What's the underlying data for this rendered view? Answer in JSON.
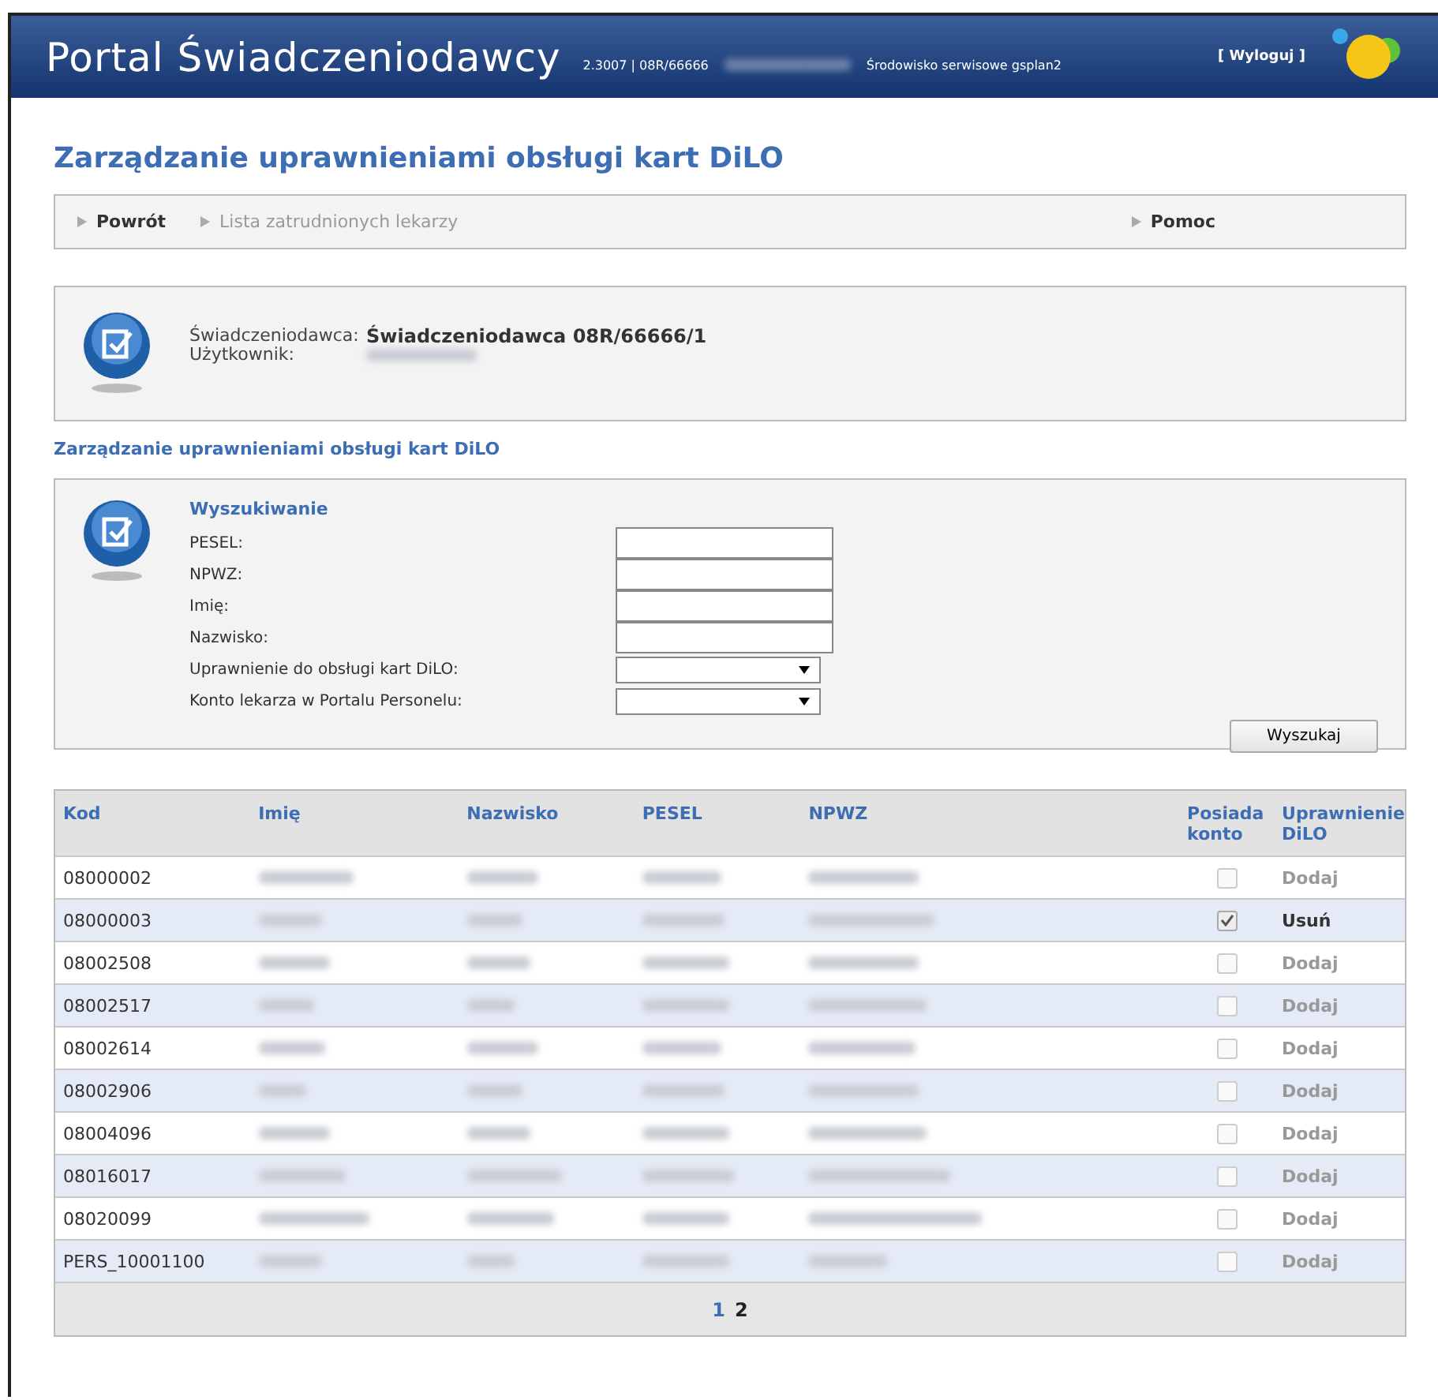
{
  "header": {
    "title": "Portal Świadczeniodawcy",
    "info": "2.3007 | 08R/66666",
    "environment": "Środowisko serwisowe gsplan2",
    "logout": "[ Wyloguj ]"
  },
  "page_title": "Zarządzanie uprawnieniami obsługi kart DiLO",
  "nav": [
    {
      "label": "Powrót",
      "disabled": false
    },
    {
      "label": "Lista zatrudnionych lekarzy",
      "disabled": true
    },
    {
      "label": "Pomoc",
      "disabled": false
    }
  ],
  "provider": {
    "provider_label": "Świadczeniodawca:",
    "provider_value": "Świadczeniodawca 08R/66666/1",
    "user_label": "Użytkownik:"
  },
  "section_title": "Zarządzanie uprawnieniami obsługi kart DiLO",
  "search": {
    "title": "Wyszukiwanie",
    "fields": [
      {
        "label": "PESEL:",
        "kind": "text"
      },
      {
        "label": "NPWZ:",
        "kind": "text"
      },
      {
        "label": "Imię:",
        "kind": "text"
      },
      {
        "label": "Nazwisko:",
        "kind": "text"
      },
      {
        "label": "Uprawnienie do obsługi kart DiLO:",
        "kind": "select"
      },
      {
        "label": "Konto lekarza w Portalu Personelu:",
        "kind": "select"
      }
    ],
    "button": "Wyszukaj"
  },
  "table": {
    "columns": [
      "Kod",
      "Imię",
      "Nazwisko",
      "PESEL",
      "NPWZ",
      "Posiada konto",
      "Uprawnienie DiLO"
    ],
    "rows": [
      {
        "kod": "08000002",
        "checked": false,
        "action": {
          "label": "Dodaj",
          "kind": "add"
        }
      },
      {
        "kod": "08000003",
        "checked": true,
        "action": {
          "label": "Usuń",
          "kind": "remove"
        }
      },
      {
        "kod": "08002508",
        "checked": false,
        "action": {
          "label": "Dodaj",
          "kind": "add"
        }
      },
      {
        "kod": "08002517",
        "checked": false,
        "action": {
          "label": "Dodaj",
          "kind": "add"
        }
      },
      {
        "kod": "08002614",
        "checked": false,
        "action": {
          "label": "Dodaj",
          "kind": "add"
        }
      },
      {
        "kod": "08002906",
        "checked": false,
        "action": {
          "label": "Dodaj",
          "kind": "add"
        }
      },
      {
        "kod": "08004096",
        "checked": false,
        "action": {
          "label": "Dodaj",
          "kind": "add"
        }
      },
      {
        "kod": "08016017",
        "checked": false,
        "action": {
          "label": "Dodaj",
          "kind": "add"
        }
      },
      {
        "kod": "08020099",
        "checked": false,
        "action": {
          "label": "Dodaj",
          "kind": "add"
        }
      },
      {
        "kod": "PERS_10001100",
        "checked": false,
        "action": {
          "label": "Dodaj",
          "kind": "add"
        }
      }
    ],
    "pages": [
      {
        "label": "1",
        "selected": false
      },
      {
        "label": "2",
        "selected": true
      }
    ]
  }
}
